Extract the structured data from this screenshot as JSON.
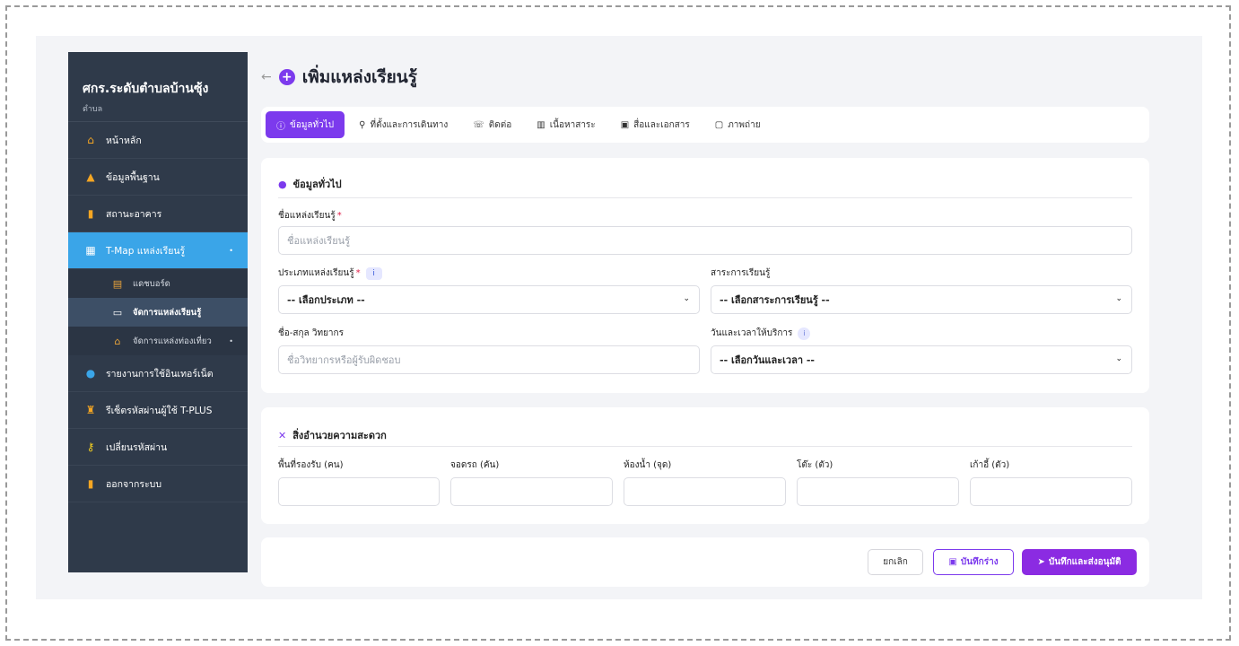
{
  "sidebar": {
    "title": "ศกร.ระดับตำบลบ้านซุ้ง",
    "subtitle": "ตำบล",
    "items": [
      {
        "label": "หน้าหลัก",
        "icon": "home-icon"
      },
      {
        "label": "ข้อมูลพื้นฐาน",
        "icon": "info-graph-icon"
      },
      {
        "label": "สถานะอาคาร",
        "icon": "building-icon"
      },
      {
        "label": "T-Map แหล่งเรียนรู้",
        "icon": "map-icon",
        "active": true
      },
      {
        "label": "รายงานการใช้อินเทอร์เน็ต",
        "icon": "globe-icon"
      },
      {
        "label": "รีเซ็ตรหัสผ่านผู้ใช้ T-PLUS",
        "icon": "user-reset-icon"
      },
      {
        "label": "เปลี่ยนรหัสผ่าน",
        "icon": "key-icon"
      },
      {
        "label": "ออกจากระบบ",
        "icon": "logout-icon"
      }
    ],
    "subitems": [
      {
        "label": "แดชบอร์ด",
        "icon": "dashboard-icon"
      },
      {
        "label": "จัดการแหล่งเรียนรู้",
        "icon": "book-icon",
        "selected": true
      },
      {
        "label": "จัดการแหล่งท่องเที่ยว",
        "icon": "landmark-icon"
      }
    ]
  },
  "header": {
    "back": "←",
    "title": "เพิ่มแหล่งเรียนรู้"
  },
  "tabs": [
    {
      "label": "ข้อมูลทั่วไป",
      "icon": "info-circle-icon",
      "active": true
    },
    {
      "label": "ที่ตั้งและการเดินทาง",
      "icon": "map-pin-icon"
    },
    {
      "label": "ติดต่อ",
      "icon": "phone-icon"
    },
    {
      "label": "เนื้อหาสาระ",
      "icon": "open-book-icon"
    },
    {
      "label": "สื่อและเอกสาร",
      "icon": "media-icon"
    },
    {
      "label": "ภาพถ่าย",
      "icon": "photo-icon"
    }
  ],
  "general": {
    "heading": "ข้อมูลทั่วไป",
    "name_label": "ชื่อแหล่งเรียนรู้",
    "name_placeholder": "ชื่อแหล่งเรียนรู้",
    "type_label": "ประเภทแหล่งเรียนรู้",
    "type_value": "-- เลือกประเภท --",
    "subject_label": "สาระการเรียนรู้",
    "subject_value": "-- เลือกสาระการเรียนรู้ --",
    "expert_label": "ชื่อ-สกุล วิทยากร",
    "expert_placeholder": "ชื่อวิทยากรหรือผู้รับผิดชอบ",
    "time_label": "วันและเวลาให้บริการ",
    "time_value": "-- เลือกวันและเวลา --"
  },
  "facilities": {
    "heading": "สิ่งอำนวยความสะดวก",
    "fields": [
      "พื้นที่รองรับ (คน)",
      "จอดรถ (คัน)",
      "ห้องน้ำ (จุด)",
      "โต๊ะ (ตัว)",
      "เก้าอี้ (ตัว)"
    ]
  },
  "footer": {
    "cancel": "ยกเลิก",
    "draft": "บันทึกร่าง",
    "submit": "บันทึกและส่งอนุมัติ"
  },
  "colors": {
    "accent": "#7c3aed",
    "sidebar": "#2f3a4a",
    "active": "#3aa5e8"
  }
}
